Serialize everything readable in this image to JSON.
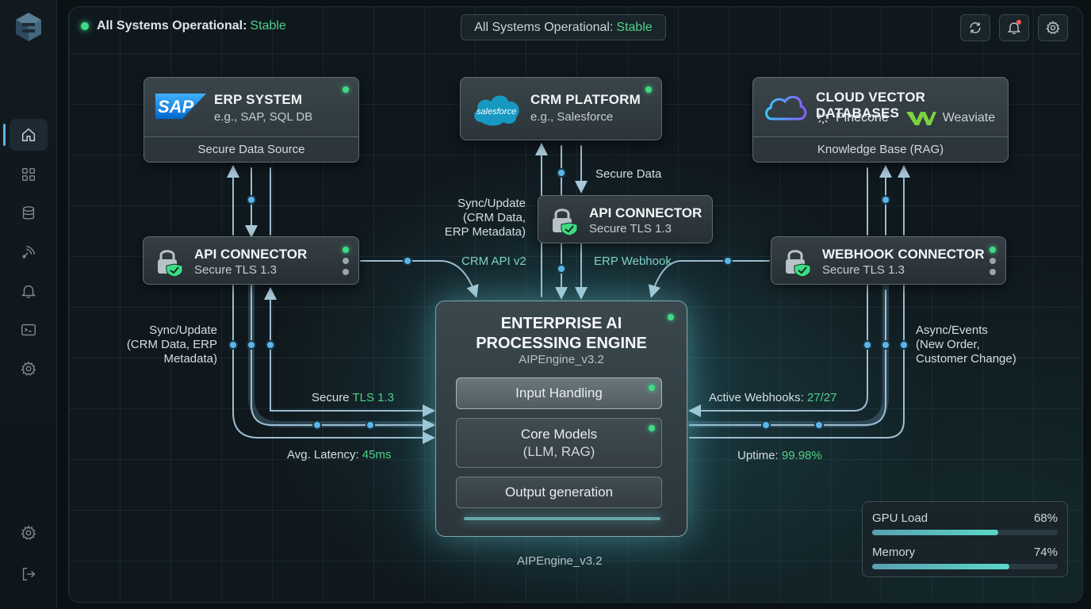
{
  "header": {
    "status_label": "All Systems Operational:",
    "status_value": "Stable",
    "pill_label": "All Systems Operational:",
    "pill_value": "Stable"
  },
  "sidebar": {
    "items": [
      {
        "icon": "home-icon",
        "active": true
      },
      {
        "icon": "grid-icon"
      },
      {
        "icon": "database-icon"
      },
      {
        "icon": "satellite-icon"
      },
      {
        "icon": "bell-icon"
      },
      {
        "icon": "terminal-icon"
      },
      {
        "icon": "gear-icon"
      }
    ],
    "bottom": [
      {
        "icon": "gear-icon"
      },
      {
        "icon": "logout-icon"
      }
    ]
  },
  "erp": {
    "title": "ERP SYSTEM",
    "sub": "e.g., SAP, SQL DB",
    "footer": "Secure Data Source",
    "logo": "SAP"
  },
  "crm": {
    "title": "CRM PLATFORM",
    "sub": "e.g., Salesforce",
    "logo": "salesforce"
  },
  "cloud": {
    "title": "CLOUD VECTOR DATABASES",
    "pinecone": "Pinecone",
    "weaviate": "Weaviate",
    "footer": "Knowledge Base (RAG)"
  },
  "connectors": {
    "left": {
      "title": "API CONNECTOR",
      "sub": "Secure TLS 1.3"
    },
    "center": {
      "title": "API CONNECTOR",
      "sub": "Secure TLS 1.3"
    },
    "right": {
      "title": "WEBHOOK CONNECTOR",
      "sub": "Secure TLS 1.3"
    }
  },
  "labels": {
    "secure_data": "Secure Data",
    "sync_center_1": "Sync/Update",
    "sync_center_2": "(CRM Data,",
    "sync_center_3": "ERP Metadata)",
    "crm_api": "CRM API v2",
    "erp_webhook": "ERP Webhook",
    "sync_left_1": "Sync/Update",
    "sync_left_2": "(CRM Data, ERP",
    "sync_left_3": "Metadata)",
    "async_1": "Async/Events",
    "async_2": "(New Order,",
    "async_3": "Customer Change)",
    "secure_tls_prefix": "Secure",
    "secure_tls_value": "TLS 1.3",
    "latency_prefix": "Avg. Latency:",
    "latency_value": "45ms",
    "webhooks_prefix": "Active Webhooks:",
    "webhooks_value": "27/27",
    "uptime_prefix": "Uptime:",
    "uptime_value": "99.98%",
    "engine_bottom": "AIPEngine_v3.2"
  },
  "engine": {
    "title_1": "ENTERPRISE AI",
    "title_2": "PROCESSING ENGINE",
    "version": "AIPEngine_v3.2",
    "modules": [
      {
        "label": "Input Handling"
      },
      {
        "label_1": "Core Models",
        "label_2": "(LLM, RAG)"
      },
      {
        "label": "Output generation"
      }
    ]
  },
  "stats": {
    "gpu_label": "GPU Load",
    "gpu_value": "68%",
    "gpu_fraction": 0.68,
    "mem_label": "Memory",
    "mem_value": "74%",
    "mem_fraction": 0.74
  },
  "colors": {
    "accent": "#5ab6e8",
    "ok": "#3ddc84",
    "value_green": "#4fd08a"
  }
}
